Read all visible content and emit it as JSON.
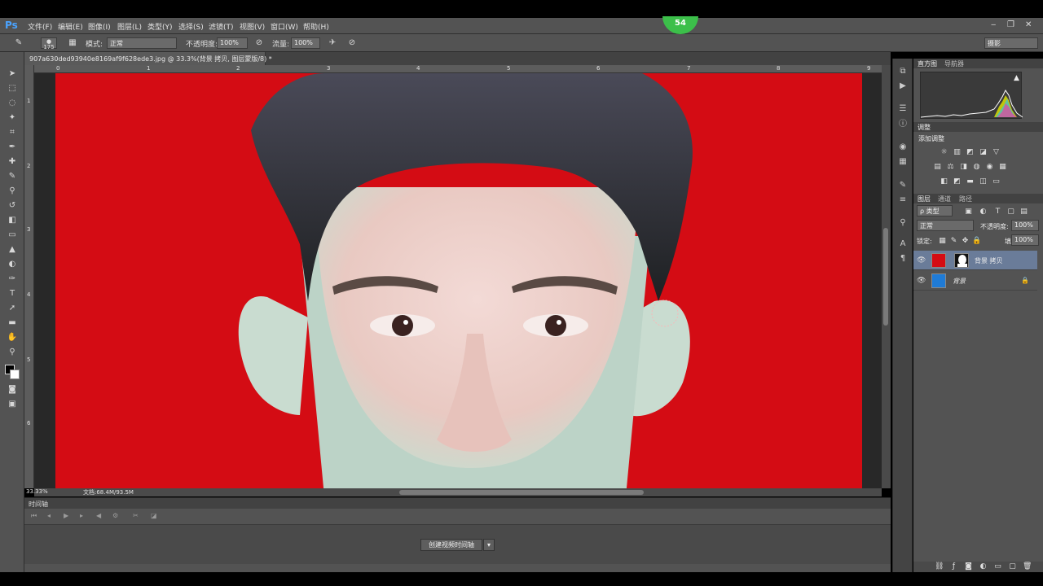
{
  "app": {
    "logo": "Ps",
    "badge_count": "54"
  },
  "menu": {
    "items": [
      "文件(F)",
      "编辑(E)",
      "图像(I)",
      "图层(L)",
      "类型(Y)",
      "选择(S)",
      "滤镜(T)",
      "视图(V)",
      "窗口(W)",
      "帮助(H)"
    ],
    "window_controls": [
      "‒",
      "❐",
      "✕"
    ]
  },
  "options": {
    "brush_size": "175",
    "mode_label": "模式:",
    "mode_value": "正常",
    "opacity_label": "不透明度:",
    "opacity_value": "100%",
    "flow_label": "流量:",
    "flow_value": "100%",
    "workspace": "摄影"
  },
  "document": {
    "tab_title": "907a630ded93940e8169af9f628ede3.jpg @ 33.3%(背景 拷贝, 图层蒙版/8) *",
    "ruler_ticks": [
      "0",
      "1",
      "2",
      "3",
      "4",
      "5",
      "6",
      "7",
      "8",
      "9"
    ],
    "ruler_left_ticks": [
      "1",
      "2",
      "3",
      "4",
      "5",
      "6"
    ],
    "zoom": "33.33%",
    "doc_size": "文档:68.4M/93.5M",
    "background_color": "#d40c14"
  },
  "timeline": {
    "title": "时间轴",
    "create_button": "创建视频时间轴"
  },
  "panels": {
    "top_tabs": [
      "直方图",
      "导航器"
    ],
    "adjust_tabs": [
      "调整"
    ],
    "adjust_title": "添加调整",
    "layer_tabs": [
      "图层",
      "通道",
      "路径"
    ],
    "filter_label": "ρ 类型",
    "blend_mode": "正常",
    "opacity_label": "不透明度:",
    "opacity_value": "100%",
    "lock_label": "锁定:",
    "fill_label": "填充:",
    "fill_value": "100%",
    "layers": [
      {
        "name": "背景 拷贝",
        "selected": true
      },
      {
        "name": "背景",
        "selected": false
      }
    ]
  }
}
